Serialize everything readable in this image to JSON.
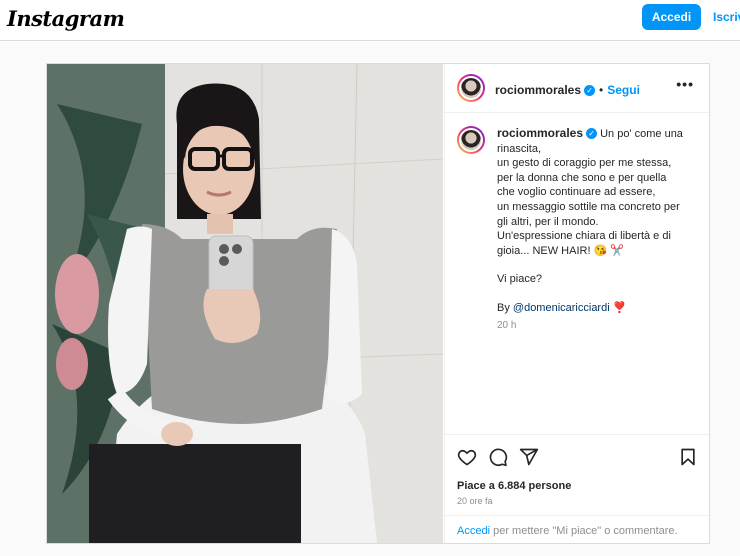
{
  "header": {
    "logo": "Instagram",
    "login_label": "Accedi",
    "signup_label": "Iscriv"
  },
  "post": {
    "username": "rociommorales",
    "follow_label": "Segui",
    "dot": "•",
    "more": "•••",
    "caption_lines": [
      "Un po' come una",
      "rinascita,",
      "un gesto di coraggio per me stessa,",
      "per la donna che sono e per quella",
      "che voglio continuare ad essere,",
      "un messaggio sottile ma concreto per",
      "gli altri, per il mondo.",
      "Un'espressione chiara di libertà e di",
      "gioia... NEW HAIR! 😘 ✂️"
    ],
    "question": "Vi piace?",
    "by_label": "By",
    "credit": "@domenicaricciardi",
    "credit_emoji": "❣️",
    "caption_time": "20 h",
    "likes": "Piace a 6.884 persone",
    "time_ago": "20 ore fa",
    "login_link": "Accedi",
    "login_prompt": "per mettere \"Mi piace\" o commentare."
  },
  "icons": {
    "like": "heart-icon",
    "comment": "comment-icon",
    "share": "share-icon",
    "save": "bookmark-icon",
    "verified": "verified-badge-icon"
  },
  "colors": {
    "accent": "#0095f6",
    "text": "#262626",
    "muted": "#8e8e8e",
    "border": "#dbdbdb"
  }
}
